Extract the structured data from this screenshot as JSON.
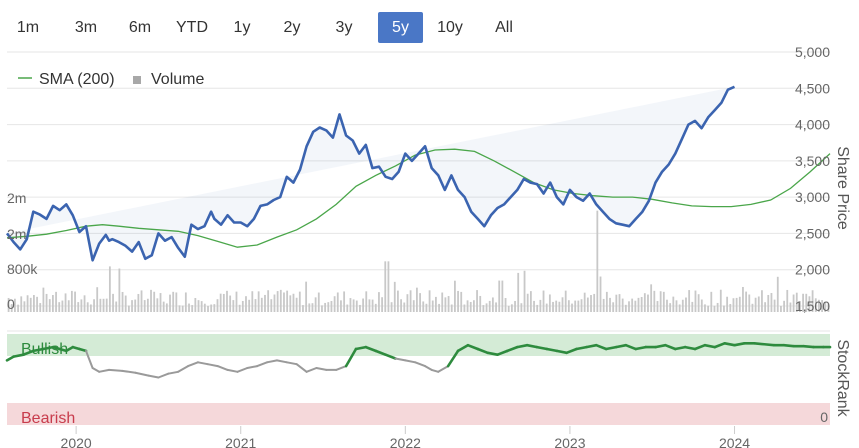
{
  "range_buttons": [
    {
      "label": "1m",
      "active": false
    },
    {
      "label": "3m",
      "active": false
    },
    {
      "label": "6m",
      "active": false
    },
    {
      "label": "YTD",
      "active": false
    },
    {
      "label": "1y",
      "active": false
    },
    {
      "label": "2y",
      "active": false
    },
    {
      "label": "3y",
      "active": false
    },
    {
      "label": "5y",
      "active": true
    },
    {
      "label": "10y",
      "active": false
    },
    {
      "label": "All",
      "active": false
    }
  ],
  "colors": {
    "price": "#3b64b0",
    "sma": "#4aa64a",
    "volume": "#c8c8c8",
    "bullish_band": "#d4ebd6",
    "bearish_band": "#f5d8da",
    "bullish_text": "#2e8b3e",
    "bearish_text": "#c83c4c",
    "stockrank_bull": "#2e8b3e",
    "stockrank_neutral": "#9a9a9a",
    "active_button": "#4a77c6"
  },
  "chart_data": {
    "type": "line",
    "legend": {
      "placement": "top-left",
      "items": [
        {
          "label": "SMA (200)",
          "kind": "line"
        },
        {
          "label": "Volume",
          "kind": "square"
        }
      ]
    },
    "price_axis": {
      "label": "Share Price",
      "range": [
        1500,
        5000
      ],
      "ticks": [
        "1,500",
        "2,000",
        "2,500",
        "3,000",
        "3,500",
        "4,000",
        "4,500",
        "5,000"
      ],
      "tick_values": [
        1500,
        2000,
        2500,
        3000,
        3500,
        4000,
        4500,
        5000
      ]
    },
    "volume_axis": {
      "ticks": [
        "0",
        "800k",
        "2m",
        "2m"
      ],
      "tick_values": [
        0,
        800000,
        1600000,
        2400000
      ],
      "range": [
        0,
        3000000
      ]
    },
    "x_axis": {
      "ticks": [
        "2020",
        "2021",
        "2022",
        "2023",
        "2024"
      ],
      "tick_values": [
        2020.0,
        2021.0,
        2022.0,
        2023.0,
        2024.0
      ],
      "range": [
        2019.58,
        2024.58
      ]
    },
    "price": {
      "name": "Price",
      "x": [
        2019.58,
        2019.62,
        2019.66,
        2019.7,
        2019.74,
        2019.78,
        2019.82,
        2019.86,
        2019.9,
        2019.94,
        2019.98,
        2020.02,
        2020.06,
        2020.1,
        2020.14,
        2020.18,
        2020.2,
        2020.22,
        2020.26,
        2020.3,
        2020.34,
        2020.38,
        2020.42,
        2020.46,
        2020.5,
        2020.54,
        2020.58,
        2020.62,
        2020.66,
        2020.7,
        2020.74,
        2020.78,
        2020.82,
        2020.84,
        2020.88,
        2020.92,
        2020.96,
        2021.0,
        2021.04,
        2021.08,
        2021.12,
        2021.16,
        2021.2,
        2021.24,
        2021.28,
        2021.32,
        2021.36,
        2021.4,
        2021.44,
        2021.48,
        2021.52,
        2021.56,
        2021.6,
        2021.64,
        2021.68,
        2021.72,
        2021.76,
        2021.8,
        2021.84,
        2021.88,
        2021.92,
        2021.96,
        2022.0,
        2022.04,
        2022.08,
        2022.12,
        2022.16,
        2022.2,
        2022.24,
        2022.28,
        2022.32,
        2022.36,
        2022.4,
        2022.44,
        2022.48,
        2022.52,
        2022.56,
        2022.6,
        2022.64,
        2022.68,
        2022.72,
        2022.76,
        2022.8,
        2022.84,
        2022.88,
        2022.92,
        2022.96,
        2023.0,
        2023.04,
        2023.08,
        2023.12,
        2023.16,
        2023.2,
        2023.24,
        2023.28,
        2023.32,
        2023.36,
        2023.4,
        2023.44,
        2023.48,
        2023.52,
        2023.56,
        2023.6,
        2023.64,
        2023.68,
        2023.72,
        2023.76,
        2023.8,
        2023.84,
        2023.88,
        2023.92,
        2023.96,
        2024.0,
        2024.04,
        2024.08,
        2024.12,
        2024.16,
        2024.2,
        2024.24,
        2024.28,
        2024.32,
        2024.36,
        2024.4,
        2024.44,
        2024.48,
        2024.52,
        2024.56,
        2024.58
      ],
      "values": [
        2500,
        2380,
        2280,
        2420,
        2800,
        2760,
        2700,
        2880,
        2820,
        2900,
        2750,
        2520,
        2600,
        2130,
        2360,
        2480,
        2400,
        2420,
        2380,
        2330,
        2250,
        2380,
        2150,
        2200,
        2500,
        2400,
        2450,
        2300,
        2180,
        2620,
        2560,
        2600,
        2800,
        2700,
        2620,
        2750,
        2650,
        2650,
        2600,
        2700,
        2880,
        2900,
        2960,
        3000,
        3280,
        3200,
        3380,
        3700,
        3900,
        3960,
        3920,
        3820,
        4140,
        3850,
        3780,
        3600,
        3720,
        3400,
        3420,
        3280,
        3250,
        3350,
        3600,
        3500,
        3600,
        3700,
        3400,
        3300,
        3100,
        3300,
        3100,
        3000,
        2800,
        2700,
        2600,
        2750,
        2850,
        2900,
        3000,
        3100,
        3250,
        3200,
        3180,
        3050,
        3200,
        3000,
        2900,
        3100,
        3000,
        2950,
        3050,
        2900,
        2800,
        2700,
        2640,
        2620,
        2600,
        2700,
        2800,
        2950,
        3200,
        3350,
        3450,
        3600,
        3800,
        4000,
        4050,
        3950,
        4100,
        4200,
        4300,
        4480,
        4520
      ]
    },
    "sma": {
      "name": "SMA (200)",
      "x": [
        2019.58,
        2019.7,
        2019.82,
        2019.94,
        2020.06,
        2020.16,
        2020.26,
        2020.38,
        2020.5,
        2020.62,
        2020.74,
        2020.86,
        2020.98,
        2021.1,
        2021.22,
        2021.34,
        2021.46,
        2021.58,
        2021.7,
        2021.82,
        2021.94,
        2022.06,
        2022.18,
        2022.3,
        2022.42,
        2022.54,
        2022.66,
        2022.78,
        2022.9,
        2023.02,
        2023.14,
        2023.26,
        2023.38,
        2023.5,
        2023.62,
        2023.74,
        2023.86,
        2023.98,
        2024.1,
        2024.22,
        2024.34,
        2024.46,
        2024.58
      ],
      "values": [
        2440,
        2460,
        2490,
        2540,
        2600,
        2620,
        2600,
        2570,
        2550,
        2530,
        2470,
        2390,
        2310,
        2340,
        2450,
        2550,
        2700,
        2900,
        3150,
        3300,
        3430,
        3580,
        3650,
        3660,
        3630,
        3500,
        3350,
        3200,
        3100,
        3050,
        3020,
        3000,
        3000,
        2970,
        2920,
        2880,
        2870,
        2870,
        2900,
        2960,
        3120,
        3350,
        3600
      ]
    },
    "volume_note": "bars"
  },
  "stockrank_chart": {
    "axis_label": "StockRank",
    "axis_tick": "0",
    "range": [
      0,
      100
    ],
    "bullish_label": "Bullish",
    "bearish_label": "Bearish",
    "bullish_threshold": 70,
    "bearish_threshold": 30,
    "points_x": [
      2019.58,
      2019.62,
      2019.68,
      2019.74,
      2019.8,
      2019.86,
      2019.9,
      2019.94,
      2019.98,
      2020.02,
      2020.06,
      2020.1,
      2020.14,
      2020.2,
      2020.28,
      2020.36,
      2020.44,
      2020.5,
      2020.56,
      2020.62,
      2020.68,
      2020.74,
      2020.8,
      2020.86,
      2020.92,
      2020.98,
      2021.04,
      2021.1,
      2021.16,
      2021.22,
      2021.28,
      2021.34,
      2021.4,
      2021.46,
      2021.52,
      2021.58,
      2021.64,
      2021.7,
      2021.76,
      2021.82,
      2021.88,
      2021.94,
      2022.0,
      2022.06,
      2022.12,
      2022.16,
      2022.2,
      2022.26,
      2022.32,
      2022.38,
      2022.44,
      2022.5,
      2022.56,
      2022.62,
      2022.68,
      2022.74,
      2022.8,
      2022.86,
      2022.92,
      2022.98,
      2023.04,
      2023.1,
      2023.16,
      2023.22,
      2023.28,
      2023.34,
      2023.4,
      2023.46,
      2023.52,
      2023.58,
      2023.64,
      2023.7,
      2023.76,
      2023.82,
      2023.88,
      2023.94,
      2024.0,
      2024.06,
      2024.12,
      2024.18,
      2024.24,
      2024.3,
      2024.36,
      2024.42,
      2024.48,
      2024.54,
      2024.58
    ],
    "points_y": [
      68,
      72,
      74,
      78,
      80,
      82,
      80,
      78,
      82,
      80,
      78,
      60,
      56,
      58,
      57,
      55,
      52,
      50,
      54,
      56,
      62,
      66,
      64,
      62,
      58,
      56,
      60,
      62,
      66,
      68,
      66,
      64,
      56,
      60,
      58,
      58,
      62,
      80,
      82,
      78,
      74,
      70,
      68,
      66,
      62,
      58,
      56,
      62,
      78,
      84,
      80,
      76,
      74,
      78,
      82,
      84,
      82,
      80,
      78,
      76,
      80,
      82,
      84,
      80,
      82,
      84,
      80,
      82,
      82,
      84,
      80,
      82,
      80,
      84,
      82,
      86,
      84,
      86,
      86,
      85,
      84,
      84,
      83,
      83,
      82,
      82,
      82
    ]
  }
}
